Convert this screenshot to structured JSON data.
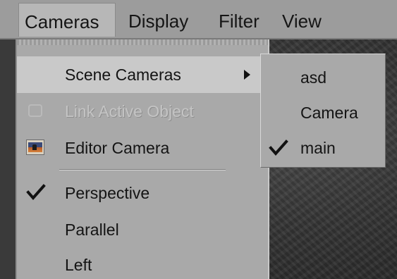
{
  "menubar": {
    "items": [
      {
        "label": "Cameras",
        "active": true
      },
      {
        "label": "Display",
        "active": false
      },
      {
        "label": "Filter",
        "active": false
      },
      {
        "label": "View",
        "active": false
      }
    ]
  },
  "cameras_menu": {
    "items": [
      {
        "label": "Scene Cameras",
        "state": "highlighted",
        "has_submenu": true,
        "icon": "chevron-right-icon"
      },
      {
        "label": "Link Active Object",
        "state": "disabled",
        "icon": "link-object-icon"
      },
      {
        "label": "Editor Camera",
        "state": "normal",
        "icon": "editor-camera-icon"
      },
      {
        "label": "Perspective",
        "state": "checked",
        "icon": "checkmark-icon"
      },
      {
        "label": "Parallel",
        "state": "normal"
      },
      {
        "label": "Left",
        "state": "normal"
      }
    ]
  },
  "scene_cameras_submenu": {
    "items": [
      {
        "label": "asd",
        "checked": false
      },
      {
        "label": "Camera",
        "checked": false
      },
      {
        "label": "main",
        "checked": true,
        "icon": "checkmark-icon"
      }
    ]
  },
  "colors": {
    "menubar_bg": "#9c9c9c",
    "menu_bg": "#a9a9a9",
    "highlight_bg": "#c9c9c9",
    "disabled_text": "#c4c4c4",
    "viewport_bg": "#2b2b2b"
  }
}
